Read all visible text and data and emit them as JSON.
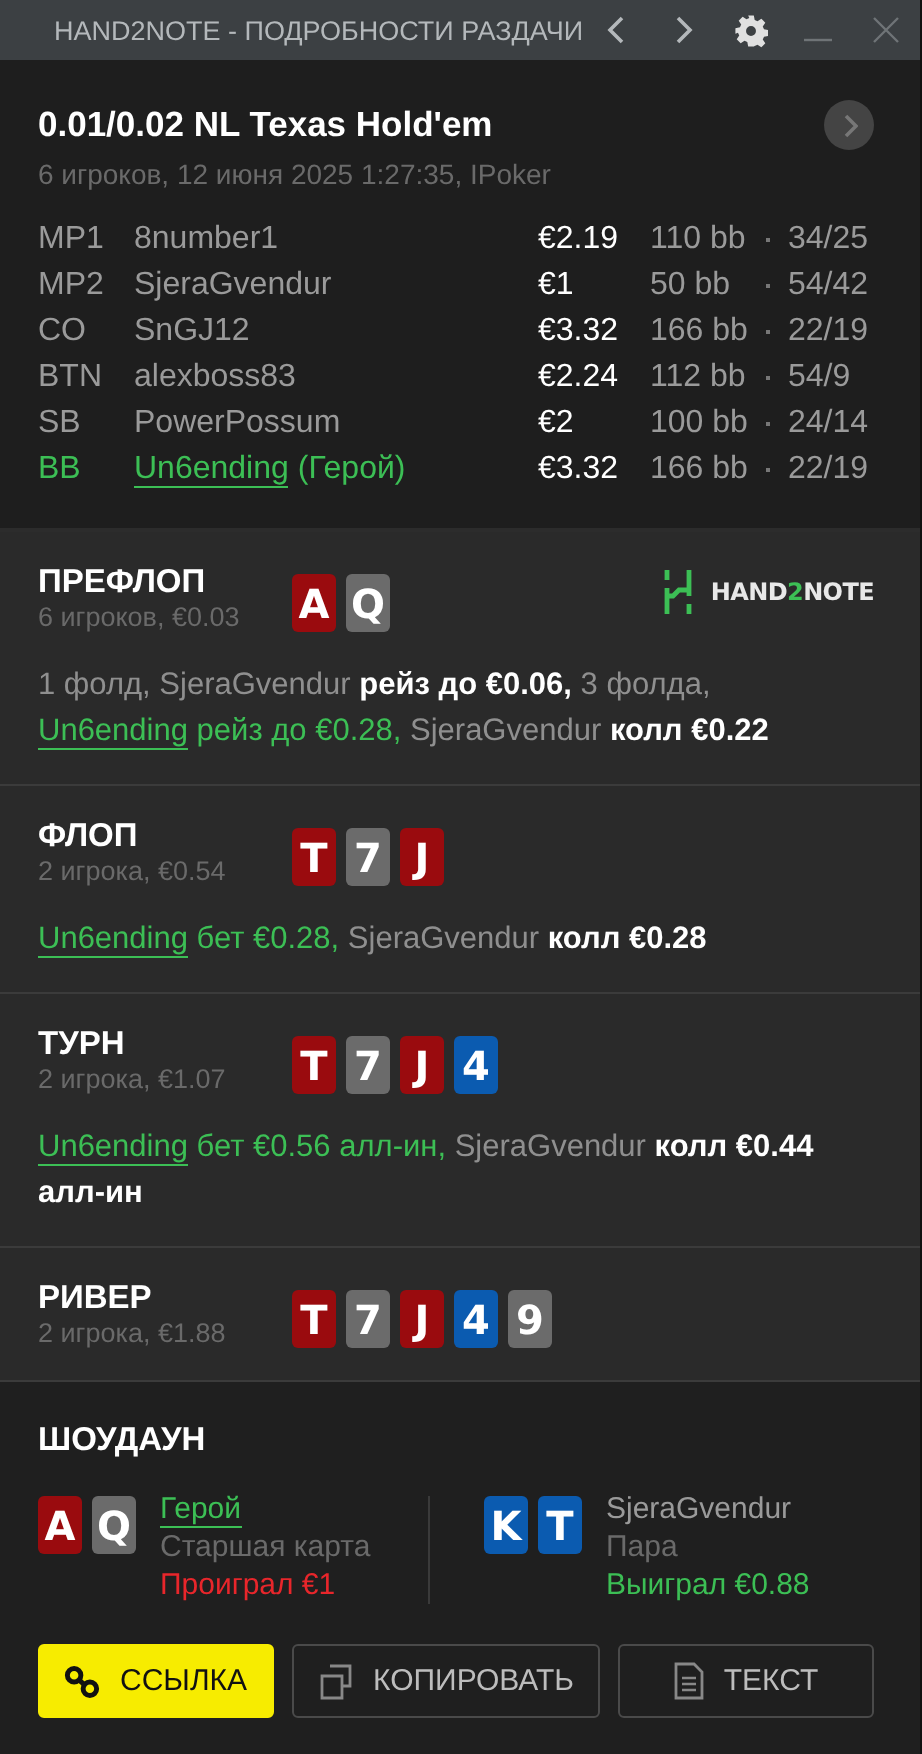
{
  "window": {
    "title": "HAND2NOTE - ПОДРОБНОСТИ РАЗДАЧИ"
  },
  "header": {
    "title": "0.01/0.02 NL Texas Hold'em",
    "subtitle": "6 игроков, 12 июня 2025 1:27:35, IPoker"
  },
  "players": [
    {
      "position": "MP1",
      "name": "8number1",
      "hero": false,
      "stack": "€2.19",
      "bb": "110 bb",
      "stats": "34/25"
    },
    {
      "position": "MP2",
      "name": "SjeraGvendur",
      "hero": false,
      "stack": "€1",
      "bb": "50 bb",
      "stats": "54/42"
    },
    {
      "position": "CO",
      "name": "SnGJ12",
      "hero": false,
      "stack": "€3.32",
      "bb": "166 bb",
      "stats": "22/19"
    },
    {
      "position": "BTN",
      "name": "alexboss83",
      "hero": false,
      "stack": "€2.24",
      "bb": "112 bb",
      "stats": "54/9"
    },
    {
      "position": "SB",
      "name": "PowerPossum",
      "hero": false,
      "stack": "€2",
      "bb": "100 bb",
      "stats": "24/14"
    },
    {
      "position": "BB",
      "name": "Un6ending",
      "hero": true,
      "hero_label": "(Герой)",
      "stack": "€3.32",
      "bb": "166 bb",
      "stats": "22/19"
    }
  ],
  "logo": {
    "parts": [
      {
        "text": "HAND",
        "accent": false
      },
      {
        "text": "2",
        "accent": true
      },
      {
        "text": "NOTE",
        "accent": false
      }
    ]
  },
  "streets": [
    {
      "name": "ПРЕФЛОП",
      "info": "6 игроков, €0.03",
      "cards": [
        {
          "rank": "A",
          "color": "#9a0b0e"
        },
        {
          "rank": "Q",
          "color": "#6b6b6b"
        }
      ],
      "actions": [
        {
          "kind": "fold",
          "text": "1 фолд,"
        },
        {
          "kind": "move",
          "player": "SjeraGvendur",
          "hero": false,
          "move": "рейз до €0.06,"
        },
        {
          "kind": "fold",
          "text": "3 фолда,"
        },
        {
          "kind": "move",
          "player": "Un6ending",
          "hero": true,
          "move": "рейз до €0.28,"
        },
        {
          "kind": "move",
          "player": "SjeraGvendur",
          "hero": false,
          "move": "колл €0.22"
        }
      ]
    },
    {
      "name": "ФЛОП",
      "info": "2 игрока, €0.54",
      "cards": [
        {
          "rank": "T",
          "color": "#9a0b0e"
        },
        {
          "rank": "7",
          "color": "#6b6b6b"
        },
        {
          "rank": "J",
          "color": "#9a0b0e"
        }
      ],
      "actions": [
        {
          "kind": "move",
          "player": "Un6ending",
          "hero": true,
          "move": "бет €0.28,"
        },
        {
          "kind": "move",
          "player": "SjeraGvendur",
          "hero": false,
          "move": "колл €0.28"
        }
      ]
    },
    {
      "name": "ТУРН",
      "info": "2 игрока, €1.07",
      "cards": [
        {
          "rank": "T",
          "color": "#9a0b0e"
        },
        {
          "rank": "7",
          "color": "#6b6b6b"
        },
        {
          "rank": "J",
          "color": "#9a0b0e"
        },
        {
          "rank": "4",
          "color": "#0b5bb0"
        }
      ],
      "actions": [
        {
          "kind": "move",
          "player": "Un6ending",
          "hero": true,
          "move": "бет €0.56 алл-ин,"
        },
        {
          "kind": "move",
          "player": "SjeraGvendur",
          "hero": false,
          "move": "колл €0.44 алл-ин"
        }
      ]
    },
    {
      "name": "РИВЕР",
      "info": "2 игрока, €1.88",
      "cards": [
        {
          "rank": "T",
          "color": "#9a0b0e"
        },
        {
          "rank": "7",
          "color": "#6b6b6b"
        },
        {
          "rank": "J",
          "color": "#9a0b0e"
        },
        {
          "rank": "4",
          "color": "#0b5bb0"
        },
        {
          "rank": "9",
          "color": "#6b6b6b"
        }
      ]
    }
  ],
  "showdown": {
    "title": "ШОУДАУН",
    "hands": [
      {
        "cards": [
          {
            "rank": "A",
            "color": "#9a0b0e"
          },
          {
            "rank": "Q",
            "color": "#6b6b6b"
          }
        ],
        "name": "Герой",
        "hero": true,
        "hand": "Старшая карта",
        "result": "Проиграл €1",
        "won": false
      },
      {
        "cards": [
          {
            "rank": "K",
            "color": "#0b5bb0"
          },
          {
            "rank": "T",
            "color": "#0b5bb0"
          }
        ],
        "name": "SjeraGvendur",
        "hero": false,
        "hand": "Пара",
        "result": "Выиграл €0.88",
        "won": true
      }
    ]
  },
  "buttons": [
    {
      "label": "ССЫЛКА",
      "primary": true
    },
    {
      "label": "КОПИРОВАТЬ",
      "primary": false
    },
    {
      "label": "ТЕКСТ",
      "primary": false
    }
  ]
}
